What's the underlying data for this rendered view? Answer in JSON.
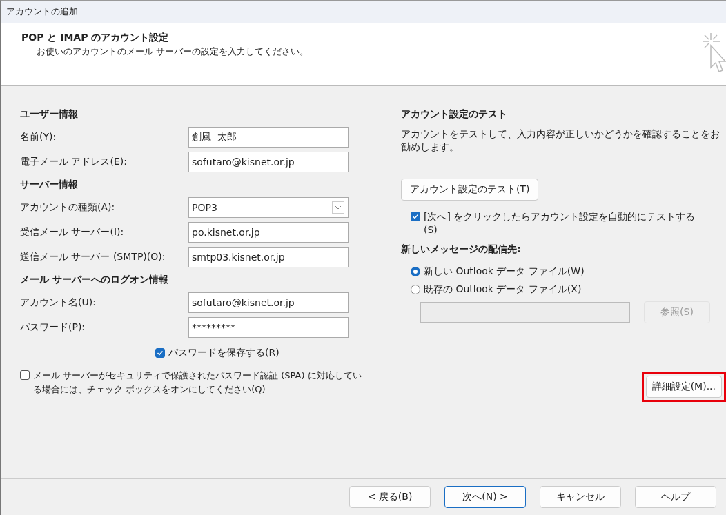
{
  "window": {
    "title": "アカウントの追加"
  },
  "header": {
    "title": "POP と IMAP のアカウント設定",
    "subtitle": "お使いのアカウントのメール サーバーの設定を入力してください。"
  },
  "left": [
    {
      "kind": "heading",
      "text": "ユーザー情報"
    },
    {
      "kind": "field",
      "label": "名前(Y):",
      "value": "創風  太郎"
    },
    {
      "kind": "field",
      "label": "電子メール アドレス(E):",
      "value": "sofutaro@kisnet.or.jp"
    },
    {
      "kind": "heading",
      "text": "サーバー情報"
    },
    {
      "kind": "select",
      "label": "アカウントの種類(A):",
      "value": "POP3"
    },
    {
      "kind": "field",
      "label": "受信メール サーバー(I):",
      "value": "po.kisnet.or.jp"
    },
    {
      "kind": "field",
      "label": "送信メール サーバー (SMTP)(O):",
      "value": "smtp03.kisnet.or.jp"
    },
    {
      "kind": "heading",
      "text": "メール サーバーへのログオン情報"
    },
    {
      "kind": "field",
      "label": "アカウント名(U):",
      "value": "sofutaro@kisnet.or.jp"
    },
    {
      "kind": "password",
      "label": "パスワード(P):",
      "value": "*********"
    }
  ],
  "save_password": {
    "label": "パスワードを保存する(R)",
    "checked": true
  },
  "spa": {
    "label": "メール サーバーがセキュリティで保護されたパスワード認証 (SPA) に対応している場合には、チェック ボックスをオンにしてください(Q)",
    "checked": false
  },
  "test": {
    "heading": "アカウント設定のテスト",
    "description": "アカウントをテストして、入力内容が正しいかどうかを確認することをお勧めします。",
    "button": "アカウント設定のテスト(T)",
    "auto_test": {
      "label": "[次へ] をクリックしたらアカウント設定を自動的にテストする (S)",
      "checked": true
    }
  },
  "delivery": {
    "heading": "新しいメッセージの配信先:",
    "options": [
      {
        "label": "新しい Outlook データ ファイル(W)",
        "selected": true
      },
      {
        "label": "既存の Outlook データ ファイル(X)",
        "selected": false
      }
    ],
    "browse_button": {
      "label": "参照(S)",
      "disabled": true
    }
  },
  "advanced_button": {
    "label": "詳細設定(M)...",
    "highlighted": true
  },
  "footer_buttons": [
    {
      "label": "< 戻る(B)",
      "default": false
    },
    {
      "label": "次へ(N) >",
      "default": true
    },
    {
      "label": "キャンセル",
      "default": false
    },
    {
      "label": "ヘルプ",
      "default": false
    }
  ]
}
